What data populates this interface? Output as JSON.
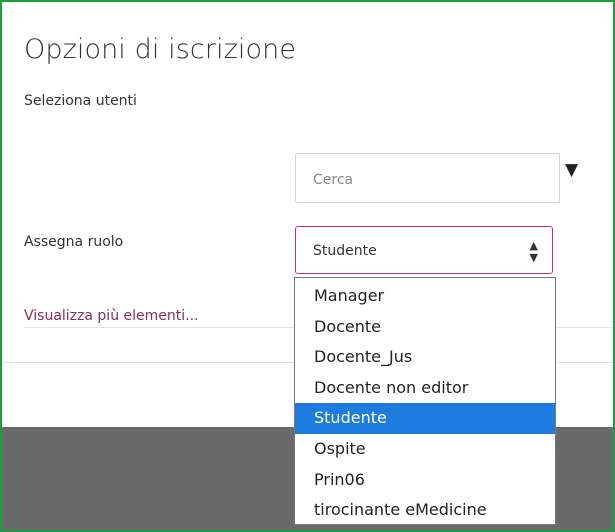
{
  "dialog": {
    "title": "Opzioni di iscrizione",
    "select_users_label": "Seleziona utenti",
    "search_placeholder": "Cerca",
    "assign_role_label": "Assegna ruolo",
    "role_selected": "Studente",
    "more_link": "Visualizza più elementi..."
  },
  "role_options": [
    "Manager",
    "Docente",
    "Docente_Jus",
    "Docente non editor",
    "Studente",
    "Ospite",
    "Prin06",
    "tirocinante eMedicine"
  ],
  "selected_option_index": 4,
  "colors": {
    "frame_border": "#1e9e3a",
    "select_border": "#c0317a",
    "link": "#8a2b5b",
    "highlight": "#1e7be0",
    "overlay": "#6a6a6a"
  }
}
